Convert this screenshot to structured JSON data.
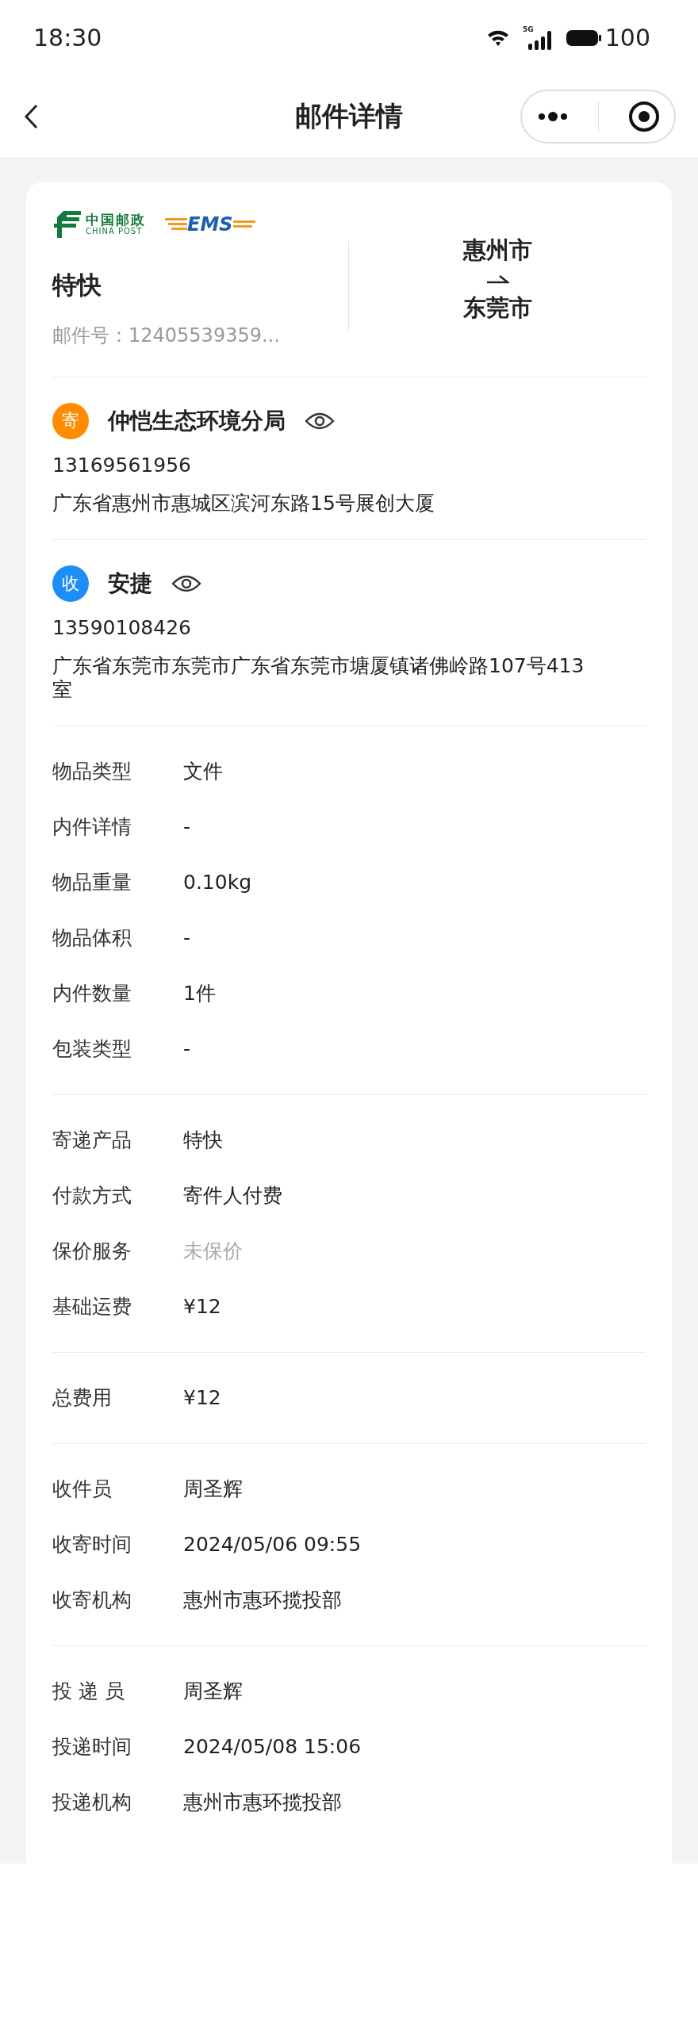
{
  "status_bar": {
    "time": "18:30",
    "network": "5G",
    "battery": "100"
  },
  "nav": {
    "title": "邮件详情"
  },
  "header": {
    "logo_cn": "中国邮政",
    "logo_en": "CHINA POST",
    "logo_ems": "EMS",
    "product": "特快",
    "mail_no": "邮件号：12405539359...",
    "from_city": "惠州市",
    "to_city": "东莞市"
  },
  "parties": [
    {
      "badge": "寄",
      "color": "#ff8c00",
      "name": "仲恺生态环境分局",
      "phone": "13169561956",
      "address": "广东省惠州市惠城区滨河东路15号展创大厦"
    },
    {
      "badge": "收",
      "color": "#1e8ef7",
      "name": "安捷",
      "phone": "13590108426",
      "address": "广东省东莞市东莞市广东省东莞市塘厦镇诸佛岭路107号413室"
    }
  ],
  "sections": [
    {
      "rows": [
        {
          "label": "物品类型",
          "value": "文件",
          "muted": false
        },
        {
          "label": "内件详情",
          "value": "-",
          "muted": false
        },
        {
          "label": "物品重量",
          "value": "0.10kg",
          "muted": false
        },
        {
          "label": "物品体积",
          "value": "-",
          "muted": false
        },
        {
          "label": "内件数量",
          "value": "1件",
          "muted": false
        },
        {
          "label": "包装类型",
          "value": "-",
          "muted": false
        }
      ]
    },
    {
      "rows": [
        {
          "label": "寄递产品",
          "value": "特快",
          "muted": false
        },
        {
          "label": "付款方式",
          "value": "寄件人付费",
          "muted": false
        },
        {
          "label": "保价服务",
          "value": "未保价",
          "muted": true
        },
        {
          "label": "基础运费",
          "value": "¥12",
          "muted": false
        }
      ]
    },
    {
      "rows": [
        {
          "label": "总费用",
          "value": "¥12",
          "muted": false
        }
      ]
    },
    {
      "rows": [
        {
          "label": "收件员",
          "value": "周圣辉",
          "muted": false
        },
        {
          "label": "收寄时间",
          "value": "2024/05/06 09:55",
          "muted": false
        },
        {
          "label": "收寄机构",
          "value": "惠州市惠环揽投部",
          "muted": false
        }
      ]
    },
    {
      "rows": [
        {
          "label": "投 递 员",
          "value": "周圣辉",
          "muted": false
        },
        {
          "label": "投递时间",
          "value": "2024/05/08 15:06",
          "muted": false
        },
        {
          "label": "投递机构",
          "value": "惠州市惠环揽投部",
          "muted": false
        }
      ]
    }
  ]
}
